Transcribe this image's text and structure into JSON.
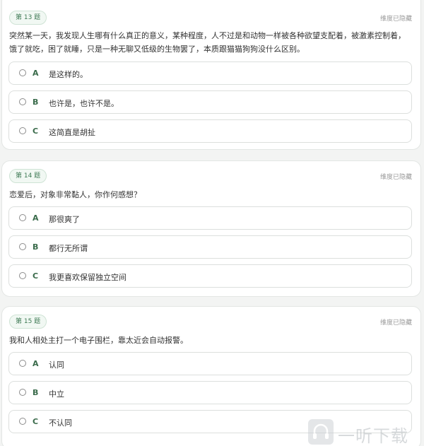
{
  "questions": [
    {
      "number_label": "第 13 题",
      "dimension_label": "维度已隐藏",
      "text": "突然某一天，我发现人生哪有什么真正的意义，某种程度，人不过是和动物一样被各种欲望支配着，被激素控制着，饿了就吃，困了就睡，只是一种无聊又低级的生物罢了，本质跟猫猫狗狗没什么区别。",
      "options": [
        {
          "letter": "A",
          "text": "是这样的。"
        },
        {
          "letter": "B",
          "text": "也许是，也许不是。"
        },
        {
          "letter": "C",
          "text": "这简直是胡扯"
        }
      ]
    },
    {
      "number_label": "第 14 题",
      "dimension_label": "维度已隐藏",
      "text": "恋爱后，对象非常黏人，你作何感想？",
      "options": [
        {
          "letter": "A",
          "text": "那很爽了"
        },
        {
          "letter": "B",
          "text": "都行无所谓"
        },
        {
          "letter": "C",
          "text": "我更喜欢保留独立空间"
        }
      ]
    },
    {
      "number_label": "第 15 题",
      "dimension_label": "维度已隐藏",
      "text": "我和人相处主打一个电子围栏，靠太近会自动报警。",
      "options": [
        {
          "letter": "A",
          "text": "认同"
        },
        {
          "letter": "B",
          "text": "中立"
        },
        {
          "letter": "C",
          "text": "不认同"
        }
      ]
    }
  ],
  "watermark": {
    "text": "一听下载",
    "icon": "headphone-logo-icon"
  }
}
